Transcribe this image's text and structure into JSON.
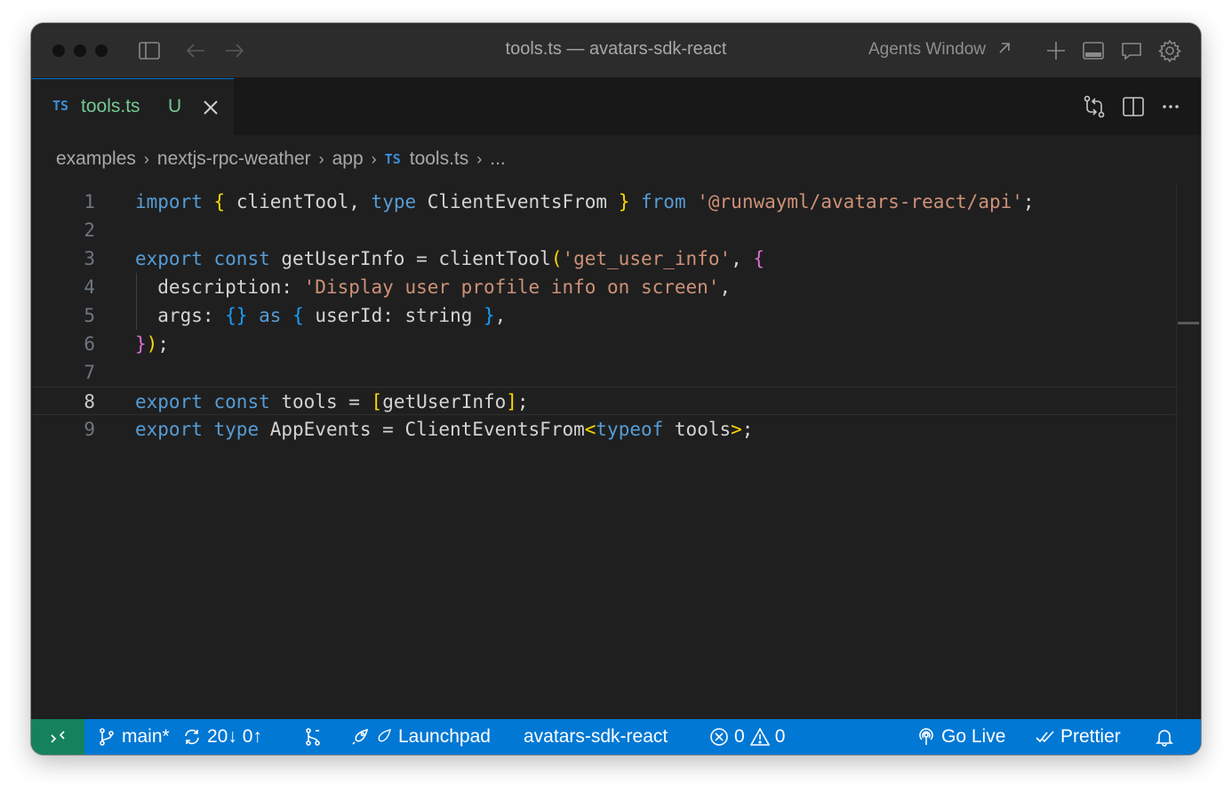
{
  "window": {
    "title": "tools.ts — avatars-sdk-react",
    "agents_window_label": "Agents Window"
  },
  "tab": {
    "badge": "TS",
    "name": "tools.ts",
    "status": "U"
  },
  "breadcrumb": {
    "items": [
      "examples",
      "nextjs-rpc-weather",
      "app"
    ],
    "file_badge": "TS",
    "file": "tools.ts",
    "more": "..."
  },
  "editor": {
    "current_line": 8,
    "lines": [
      {
        "n": "1",
        "tokens": [
          [
            "kw",
            "import"
          ],
          [
            "p",
            " "
          ],
          [
            "by",
            "{"
          ],
          [
            "p",
            " clientTool, "
          ],
          [
            "kw",
            "type"
          ],
          [
            "p",
            " ClientEventsFrom "
          ],
          [
            "by",
            "}"
          ],
          [
            "p",
            " "
          ],
          [
            "kw",
            "from"
          ],
          [
            "p",
            " "
          ],
          [
            "str",
            "'@runwayml/avatars-react/api'"
          ],
          [
            "p",
            ";"
          ]
        ]
      },
      {
        "n": "2",
        "tokens": []
      },
      {
        "n": "3",
        "tokens": [
          [
            "kw",
            "export"
          ],
          [
            "p",
            " "
          ],
          [
            "kw",
            "const"
          ],
          [
            "p",
            " getUserInfo = clientTool"
          ],
          [
            "by",
            "("
          ],
          [
            "str",
            "'get_user_info'"
          ],
          [
            "p",
            ", "
          ],
          [
            "bp",
            "{"
          ]
        ]
      },
      {
        "n": "4",
        "tokens": [
          [
            "p",
            "  description: "
          ],
          [
            "str",
            "'Display user profile info on screen'"
          ],
          [
            "p",
            ","
          ]
        ]
      },
      {
        "n": "5",
        "tokens": [
          [
            "p",
            "  args: "
          ],
          [
            "bb",
            "{}"
          ],
          [
            "p",
            " "
          ],
          [
            "kw",
            "as"
          ],
          [
            "p",
            " "
          ],
          [
            "bb",
            "{"
          ],
          [
            "p",
            " userId: string "
          ],
          [
            "bb",
            "}"
          ],
          [
            "p",
            ","
          ]
        ]
      },
      {
        "n": "6",
        "tokens": [
          [
            "bp",
            "}"
          ],
          [
            "by",
            ")"
          ],
          [
            "p",
            ";"
          ]
        ]
      },
      {
        "n": "7",
        "tokens": []
      },
      {
        "n": "8",
        "tokens": [
          [
            "kw",
            "export"
          ],
          [
            "p",
            " "
          ],
          [
            "kw",
            "const"
          ],
          [
            "p",
            " tools = "
          ],
          [
            "by",
            "["
          ],
          [
            "p",
            "getUserInfo"
          ],
          [
            "by",
            "]"
          ],
          [
            "p",
            ";"
          ]
        ]
      },
      {
        "n": "9",
        "tokens": [
          [
            "kw",
            "export"
          ],
          [
            "p",
            " "
          ],
          [
            "kw",
            "type"
          ],
          [
            "p",
            " AppEvents = ClientEventsFrom"
          ],
          [
            "by",
            "<"
          ],
          [
            "kw",
            "typeof"
          ],
          [
            "p",
            " tools"
          ],
          [
            "by",
            ">"
          ],
          [
            "p",
            ";"
          ]
        ]
      }
    ]
  },
  "statusbar": {
    "branch": "main*",
    "sync": "20↓ 0↑",
    "launchpad": "Launchpad",
    "project": "avatars-sdk-react",
    "errors": "0",
    "warnings": "0",
    "go_live": "Go Live",
    "prettier": "Prettier"
  },
  "colors": {
    "status_bar": "#0078d4",
    "remote_indicator": "#16825d",
    "keyword": "#569cd6",
    "string": "#ce9178",
    "untracked": "#73c991"
  }
}
